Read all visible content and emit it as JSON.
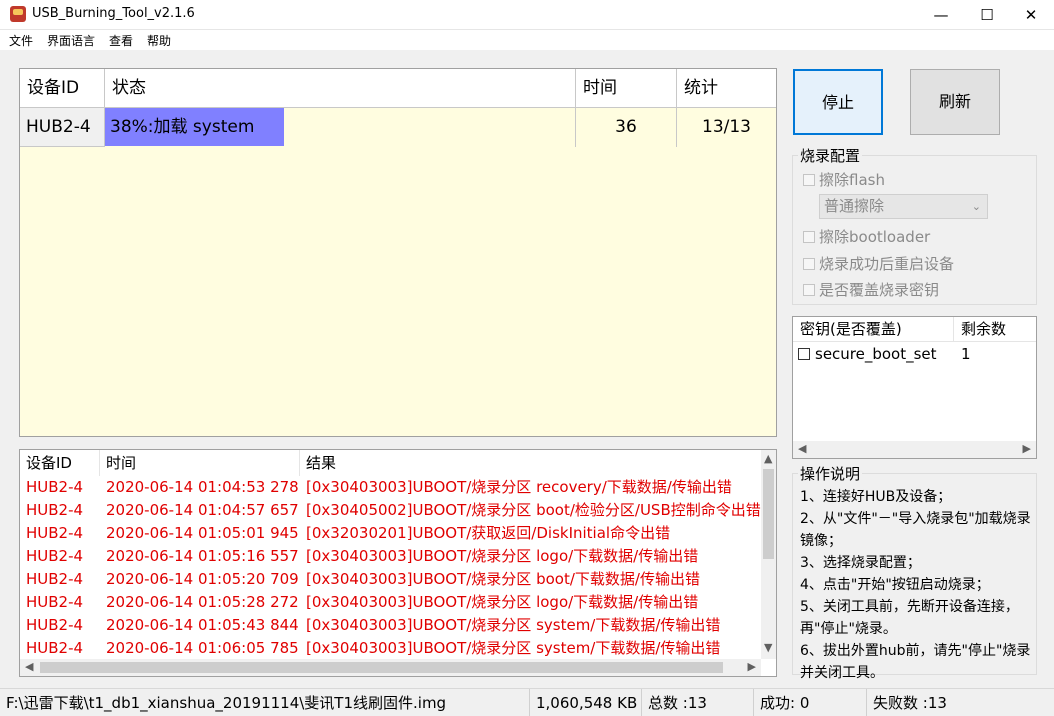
{
  "window": {
    "title": "USB_Burning_Tool_v2.1.6"
  },
  "window_controls": {
    "minimize": "—",
    "maximize": "☐",
    "close": "✕"
  },
  "menu": [
    "文件",
    "界面语言",
    "查看",
    "帮助"
  ],
  "device_table": {
    "headers": [
      "设备ID",
      "状态",
      "时间",
      "统计"
    ],
    "rows": [
      {
        "id": "HUB2-4",
        "status": "38%:加载 system",
        "progress_percent": 38,
        "time": "36",
        "count": "13/13"
      }
    ]
  },
  "buttons": {
    "stop": "停止",
    "refresh": "刷新"
  },
  "burn_config": {
    "title": "烧录配置",
    "erase_flash": "擦除flash",
    "erase_mode": "普通擦除",
    "erase_bootloader": "擦除bootloader",
    "reboot_after": "烧录成功后重启设备",
    "overwrite_key": "是否覆盖烧录密钥"
  },
  "key_table": {
    "headers": [
      "密钥(是否覆盖)",
      "剩余数"
    ],
    "rows": [
      {
        "name": "secure_boot_set",
        "remaining": "1"
      }
    ]
  },
  "log_table": {
    "headers": [
      "设备ID",
      "时间",
      "结果"
    ],
    "rows": [
      {
        "id": "HUB2-4",
        "time": "2020-06-14 01:04:53 278",
        "result": "[0x30403003]UBOOT/烧录分区 recovery/下载数据/传输出错"
      },
      {
        "id": "HUB2-4",
        "time": "2020-06-14 01:04:57 657",
        "result": "[0x30405002]UBOOT/烧录分区 boot/检验分区/USB控制命令出错"
      },
      {
        "id": "HUB2-4",
        "time": "2020-06-14 01:05:01 945",
        "result": "[0x32030201]UBOOT/获取返回/DiskInitial命令出错"
      },
      {
        "id": "HUB2-4",
        "time": "2020-06-14 01:05:16 557",
        "result": "[0x30403003]UBOOT/烧录分区 logo/下载数据/传输出错"
      },
      {
        "id": "HUB2-4",
        "time": "2020-06-14 01:05:20 709",
        "result": "[0x30403003]UBOOT/烧录分区 boot/下载数据/传输出错"
      },
      {
        "id": "HUB2-4",
        "time": "2020-06-14 01:05:28 272",
        "result": "[0x30403003]UBOOT/烧录分区 logo/下载数据/传输出错"
      },
      {
        "id": "HUB2-4",
        "time": "2020-06-14 01:05:43 844",
        "result": "[0x30403003]UBOOT/烧录分区 system/下载数据/传输出错"
      },
      {
        "id": "HUB2-4",
        "time": "2020-06-14 01:06:05 785",
        "result": "[0x30403003]UBOOT/烧录分区 system/下载数据/传输出错"
      }
    ]
  },
  "instructions": {
    "title": "操作说明",
    "steps": [
      "1、连接好HUB及设备；",
      "2、从\"文件\"－\"导入烧录包\"加载烧录镜像；",
      "3、选择烧录配置；",
      "4、点击\"开始\"按钮启动烧录；",
      "5、关闭工具前，先断开设备连接，再\"停止\"烧录。",
      "6、拔出外置hub前，请先\"停止\"烧录并关闭工具。"
    ]
  },
  "status_bar": {
    "file_path": "F:\\迅雷下载\\t1_db1_xianshua_20191114\\斐讯T1线刷固件.img",
    "file_size": "1,060,548 KB",
    "total": "总数 :13",
    "success": "成功:  0",
    "failed": "失败数 :13"
  },
  "colors": {
    "progress": "#8080ff",
    "table_bg": "#fffde0",
    "log_text": "#e00000",
    "accent": "#0078d7"
  }
}
